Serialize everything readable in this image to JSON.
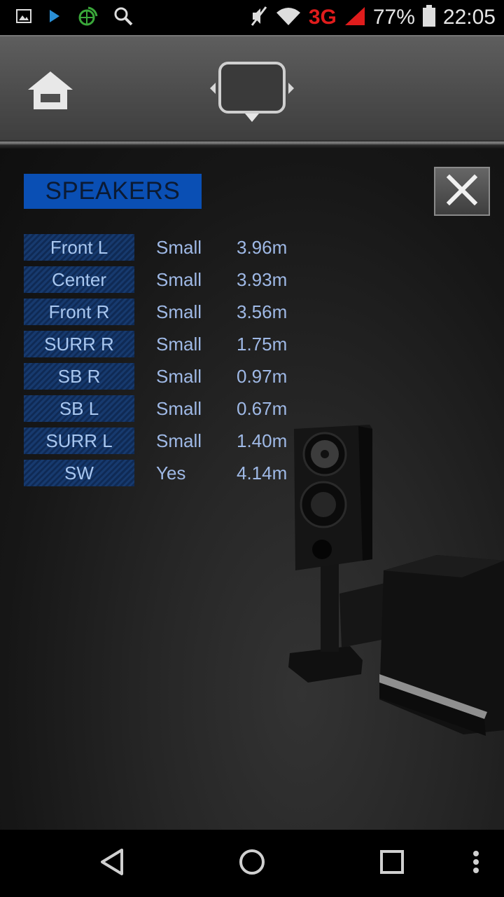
{
  "status_bar": {
    "battery_percent": "77%",
    "time": "22:05",
    "network": "3G"
  },
  "header": {
    "home_icon": "home-icon",
    "screen_icon": "tv-screen-icon"
  },
  "panel": {
    "title": "SPEAKERS",
    "close_icon": "close-icon",
    "speakers": [
      {
        "name": "Front L",
        "size": "Small",
        "distance": "3.96m"
      },
      {
        "name": "Center",
        "size": "Small",
        "distance": "3.93m"
      },
      {
        "name": "Front R",
        "size": "Small",
        "distance": "3.56m"
      },
      {
        "name": "SURR R",
        "size": "Small",
        "distance": "1.75m"
      },
      {
        "name": "SB R",
        "size": "Small",
        "distance": "0.97m"
      },
      {
        "name": "SB L",
        "size": "Small",
        "distance": "0.67m"
      },
      {
        "name": "SURR L",
        "size": "Small",
        "distance": "1.40m"
      },
      {
        "name": "SW",
        "size": "Yes",
        "distance": "4.14m"
      }
    ]
  },
  "colors": {
    "title_bg": "#0a4fb4",
    "row_text": "#9fb9e6",
    "signal_red": "#e01c1c"
  }
}
